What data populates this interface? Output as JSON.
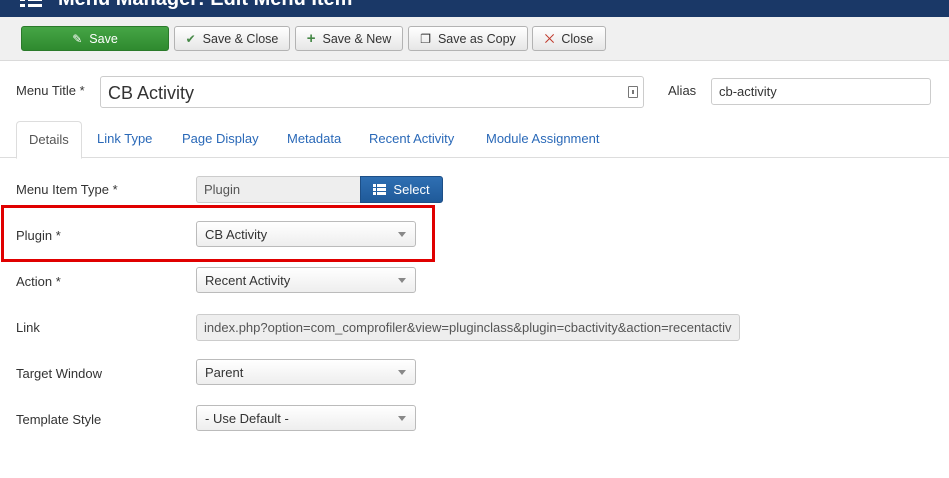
{
  "header": {
    "title": "Menu Manager: Edit Menu Item",
    "icon": "menu-list-icon"
  },
  "toolbar": {
    "save": {
      "label": "Save",
      "icon": "edit-icon"
    },
    "save_close": {
      "label": "Save & Close",
      "icon": "check-icon"
    },
    "save_new": {
      "label": "Save & New",
      "icon": "plus-icon"
    },
    "save_copy": {
      "label": "Save as Copy",
      "icon": "copy-icon"
    },
    "close": {
      "label": "Close",
      "icon": "close-circle-icon"
    }
  },
  "form": {
    "title_label": "Menu Title *",
    "title_value": "CB Activity",
    "alias_label": "Alias",
    "alias_value": "cb-activity"
  },
  "tabs": [
    "Details",
    "Link Type",
    "Page Display",
    "Metadata",
    "Recent Activity",
    "Module Assignment"
  ],
  "details": {
    "menu_item_type_label": "Menu Item Type *",
    "menu_item_type_value": "Plugin",
    "select_label": "Select",
    "plugin_label": "Plugin *",
    "plugin_value": "CB Activity",
    "action_label": "Action *",
    "action_value": "Recent Activity",
    "link_label": "Link",
    "link_value": "index.php?option=com_comprofiler&view=pluginclass&plugin=cbactivity&action=recentactiv",
    "target_label": "Target Window",
    "target_value": "Parent",
    "template_label": "Template Style",
    "template_value": "- Use Default -"
  },
  "colors": {
    "header": "#1a3867",
    "save": "#3c9a3c",
    "select": "#2a65a8",
    "highlight": "#e00000",
    "link": "#2a69b8"
  }
}
